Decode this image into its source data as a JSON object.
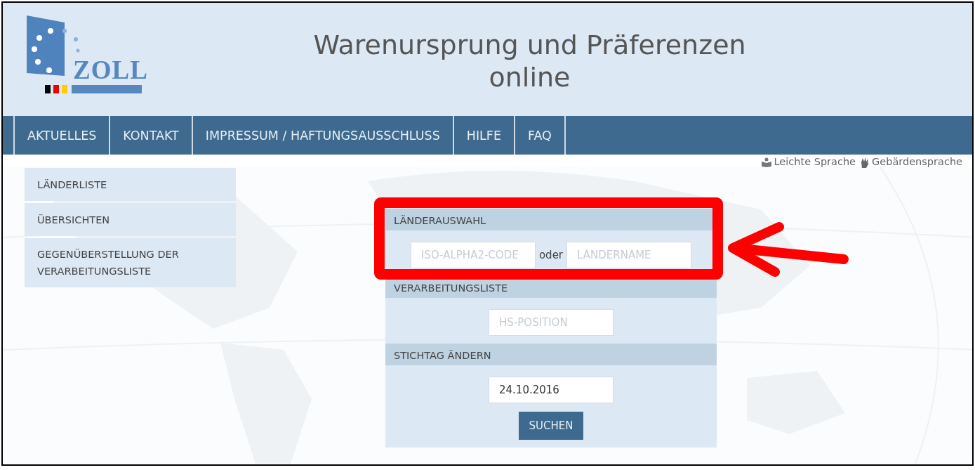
{
  "header": {
    "logo_text": "ZOLL",
    "title_lines": [
      "Warenursprung und Präferenzen",
      "online"
    ]
  },
  "nav": [
    {
      "label": "AKTUELLES"
    },
    {
      "label": "KONTAKT"
    },
    {
      "label": "IMPRESSUM / HAFTUNGSAUSSCHLUSS"
    },
    {
      "label": "HILFE"
    },
    {
      "label": "FAQ"
    }
  ],
  "accessibility_links": [
    {
      "label": "Leichte Sprache",
      "kind": "easy-language"
    },
    {
      "label": "Gebärdensprache",
      "kind": "sign-language"
    }
  ],
  "sidebar": {
    "items": [
      {
        "label": "LÄNDERLISTE"
      },
      {
        "label": "ÜBERSICHTEN"
      },
      {
        "label": "GEGENÜBERSTELLUNG DER VERARBEITUNGSLISTE"
      }
    ]
  },
  "form": {
    "sections": [
      {
        "heading": "LÄNDERAUSWAHL",
        "items": [
          {
            "kind": "field",
            "placeholder": "ISO-ALPHA2-CODE"
          },
          {
            "kind": "text",
            "text": "oder"
          },
          {
            "kind": "field",
            "placeholder": "LÄNDERNAME"
          }
        ]
      },
      {
        "heading": "VERARBEITUNGSLISTE",
        "items": [
          {
            "kind": "field",
            "placeholder": "HS-POSITION"
          }
        ]
      },
      {
        "heading": "STICHTAG ÄNDERN",
        "items": [
          {
            "kind": "field",
            "value": "24.10.2016"
          }
        ]
      }
    ],
    "button": "SUCHEN"
  }
}
